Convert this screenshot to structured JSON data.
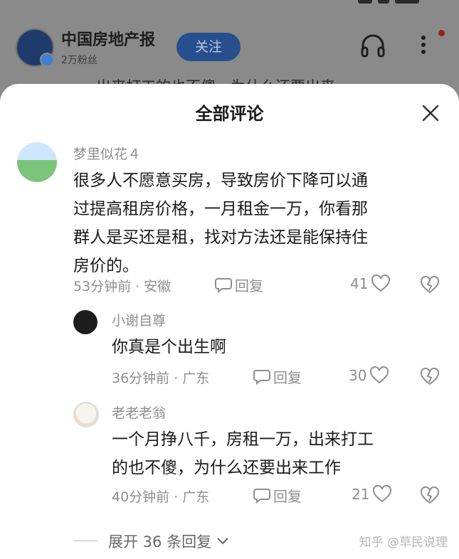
{
  "background": {
    "org_name": "中国房地产报",
    "org_fans": "2万粉丝",
    "follow_label": "关注",
    "article_snippet": "出来打工的也不傻，为什么还要出来"
  },
  "sheet": {
    "title": "全部评论",
    "close_icon": "close-icon"
  },
  "comments": [
    {
      "user": "梦里似花４",
      "lines": [
        "很多人不愿意买房，导致房价下降可以通",
        "过提高租房价格，一月租金一万，你看那",
        "群人是买还是租，找对方法还是能保持住",
        "房价的。"
      ],
      "time_loc": "53分钟前 · 安徽",
      "reply_label": "回复",
      "likes": "41"
    },
    {
      "user": "小谢自尊",
      "lines": [
        "你真是个出生啊"
      ],
      "time_loc": "36分钟前 · 广东",
      "reply_label": "回复",
      "likes": "30"
    },
    {
      "user": "老老老翁",
      "lines": [
        "一个月挣八千，房租一万，出来打工",
        "的也不傻，为什么还要出来工作"
      ],
      "time_loc": "40分钟前 · 广东",
      "reply_label": "回复",
      "likes": "21"
    }
  ],
  "expand_label": "展开 36 条回复",
  "watermark": "知乎 @草民说理",
  "colors": {
    "follow_bg": "#274f8e",
    "text_primary": "#1a1a1a",
    "text_secondary": "#8e8e8e"
  }
}
